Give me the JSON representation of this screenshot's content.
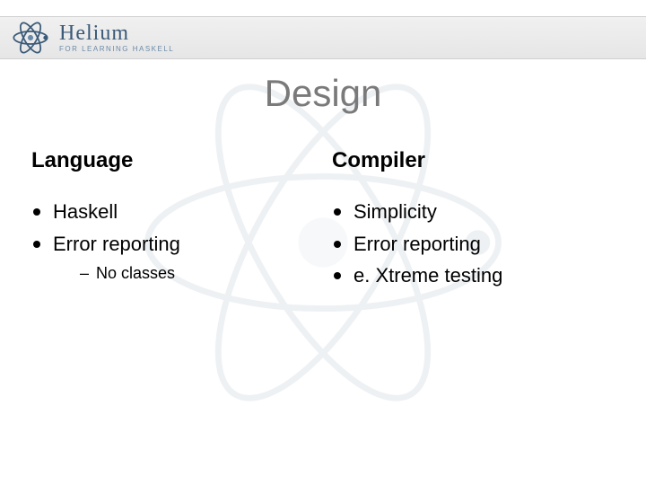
{
  "logo": {
    "name": "Helium",
    "tagline": "FOR LEARNING HASKELL"
  },
  "title": "Design",
  "columns": {
    "left": {
      "heading": "Language",
      "items": [
        {
          "text": "Haskell"
        },
        {
          "text": "Error reporting",
          "sub": [
            "No classes"
          ]
        }
      ]
    },
    "right": {
      "heading": "Compiler",
      "items": [
        {
          "text": "Simplicity"
        },
        {
          "text": "Error reporting"
        },
        {
          "text": "e. Xtreme testing"
        }
      ]
    }
  }
}
